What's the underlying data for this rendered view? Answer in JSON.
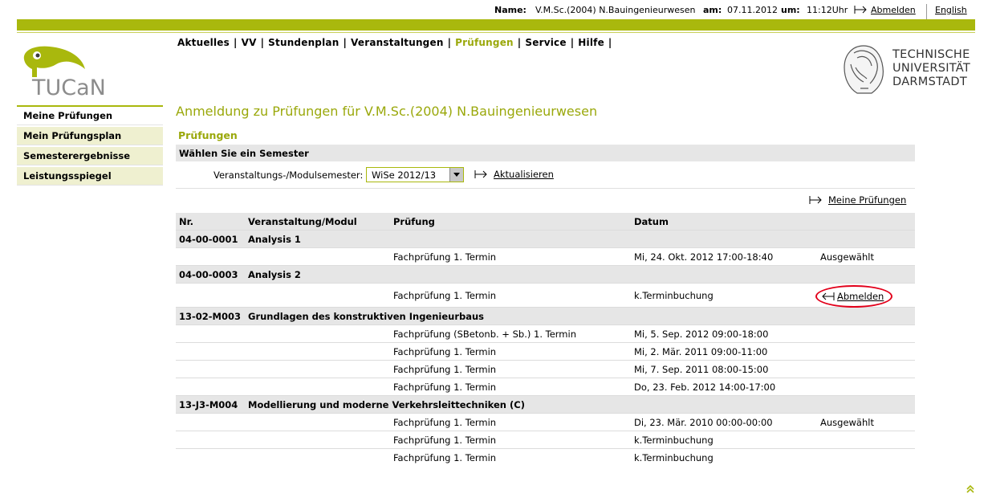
{
  "topbar": {
    "name_label": "Name:",
    "name_value": "V.M.Sc.(2004) N.Bauingenieurwesen",
    "am_label": "am:",
    "date_value": "07.11.2012",
    "um_label": "um:",
    "time_value": "11:12Uhr",
    "logout_label": "Abmelden",
    "language_label": "English"
  },
  "mainnav": {
    "items": [
      {
        "label": "Aktuelles"
      },
      {
        "label": "VV"
      },
      {
        "label": "Stundenplan"
      },
      {
        "label": "Veranstaltungen"
      },
      {
        "label": "Prüfungen",
        "active": true
      },
      {
        "label": "Service"
      },
      {
        "label": "Hilfe"
      }
    ]
  },
  "logo": {
    "tucan_text": "TUCaN",
    "tu_lines": [
      "TECHNISCHE",
      "UNIVERSITÄT",
      "DARMSTADT"
    ]
  },
  "sidenav": {
    "items": [
      {
        "label": "Meine Prüfungen",
        "active": true
      },
      {
        "label": "Mein Prüfungsplan"
      },
      {
        "label": "Semesterergebnisse"
      },
      {
        "label": "Leistungsspiegel"
      }
    ]
  },
  "content": {
    "page_title": "Anmeldung zu Prüfungen für V.M.Sc.(2004) N.Bauingenieurwesen",
    "section_title": "Prüfungen",
    "choose_semester": "Wählen Sie ein Semester",
    "semester_label": "Veranstaltungs-/Modulsemester:",
    "semester_value": "WiSe 2012/13",
    "refresh_label": "Aktualisieren",
    "my_exams_label": "Meine Prüfungen"
  },
  "table": {
    "headers": {
      "nr": "Nr.",
      "module": "Veranstaltung/Modul",
      "exam": "Prüfung",
      "date": "Datum"
    },
    "groups": [
      {
        "nr": "04-00-0001",
        "module": "Analysis 1",
        "rows": [
          {
            "exam": "Fachprüfung 1. Termin",
            "date": "Mi, 24. Okt. 2012 17:00-18:40",
            "status": "Ausgewählt"
          }
        ]
      },
      {
        "nr": "04-00-0003",
        "module": "Analysis 2",
        "rows": [
          {
            "exam": "Fachprüfung 1. Termin",
            "date": "k.Terminbuchung",
            "action": "Abmelden"
          }
        ]
      },
      {
        "nr": "13-02-M003",
        "module": "Grundlagen des konstruktiven Ingenieurbaus",
        "rows": [
          {
            "exam": "Fachprüfung (SBetonb. + Sb.) 1. Termin",
            "date": "Mi, 5. Sep. 2012 09:00-18:00"
          },
          {
            "exam": "Fachprüfung 1. Termin",
            "date": "Mi, 2. Mär. 2011 09:00-11:00"
          },
          {
            "exam": "Fachprüfung 1. Termin",
            "date": "Mi, 7. Sep. 2011 08:00-15:00"
          },
          {
            "exam": "Fachprüfung 1. Termin",
            "date": "Do, 23. Feb. 2012 14:00-17:00"
          }
        ]
      },
      {
        "nr": "13-J3-M004",
        "module": "Modellierung und moderne Verkehrsleittechniken (C)",
        "rows": [
          {
            "exam": "Fachprüfung 1. Termin",
            "date": "Di, 23. Mär. 2010 00:00-00:00",
            "status": "Ausgewählt"
          },
          {
            "exam": "Fachprüfung 1. Termin",
            "date": "k.Terminbuchung"
          },
          {
            "exam": "Fachprüfung 1. Termin",
            "date": "k.Terminbuchung"
          }
        ]
      }
    ]
  },
  "colors": {
    "brand_green": "#a9b80d",
    "title_green": "#9aa80b",
    "highlight_red": "#e2001a"
  }
}
